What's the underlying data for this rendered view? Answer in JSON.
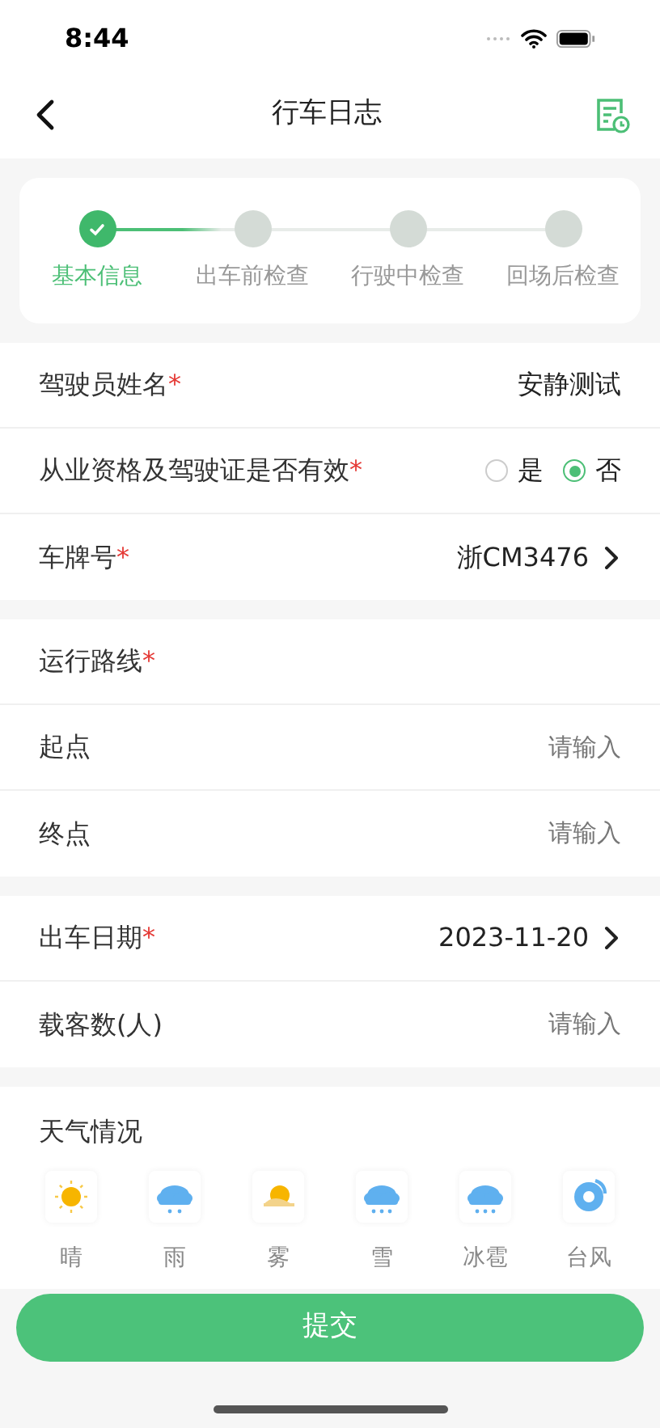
{
  "status_bar": {
    "time": "8:44"
  },
  "nav": {
    "title": "行车日志"
  },
  "required_mark": "*",
  "steps": [
    {
      "label": "基本信息",
      "done": true
    },
    {
      "label": "出车前检查",
      "done": false
    },
    {
      "label": "行驶中检查",
      "done": false
    },
    {
      "label": "回场后检查",
      "done": false
    }
  ],
  "sections": [
    {
      "rows": [
        {
          "kind": "text",
          "label": "驾驶员姓名",
          "required": true,
          "value": "安静测试"
        },
        {
          "kind": "radio",
          "label": "从业资格及驾驶证是否有效",
          "required": true,
          "options": [
            {
              "label": "是",
              "selected": false
            },
            {
              "label": "否",
              "selected": true
            }
          ]
        },
        {
          "kind": "select",
          "label": "车牌号",
          "required": true,
          "value": "浙CM3476"
        }
      ]
    },
    {
      "rows": [
        {
          "kind": "header",
          "label": "运行路线",
          "required": true
        },
        {
          "kind": "input",
          "label": "起点",
          "required": false,
          "placeholder": "请输入"
        },
        {
          "kind": "input",
          "label": "终点",
          "required": false,
          "placeholder": "请输入"
        }
      ]
    },
    {
      "rows": [
        {
          "kind": "select",
          "label": "出车日期",
          "required": true,
          "value": "2023-11-20"
        },
        {
          "kind": "input",
          "label": "载客数(人)",
          "required": false,
          "placeholder": "请输入"
        }
      ]
    }
  ],
  "weather": {
    "title": "天气情况",
    "items": [
      {
        "kind": "sunny",
        "label": "晴"
      },
      {
        "kind": "rain",
        "label": "雨"
      },
      {
        "kind": "fog",
        "label": "雾"
      },
      {
        "kind": "snow",
        "label": "雪"
      },
      {
        "kind": "hail",
        "label": "冰雹"
      },
      {
        "kind": "typhoon",
        "label": "台风"
      }
    ]
  },
  "submit": {
    "label": "提交"
  }
}
